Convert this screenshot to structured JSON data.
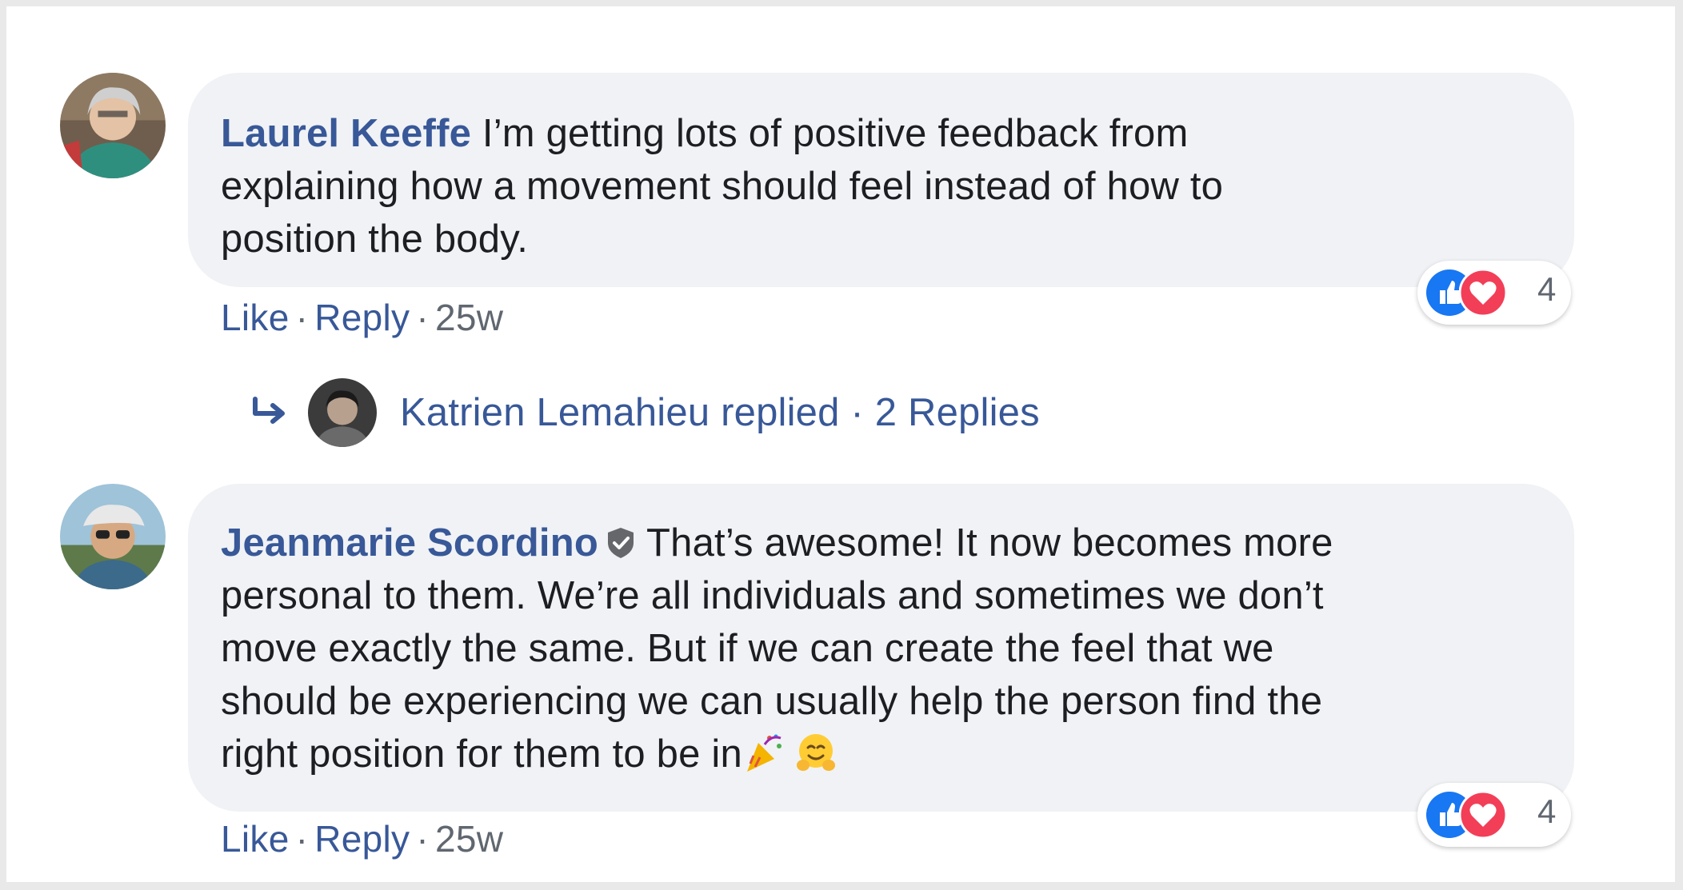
{
  "comments": [
    {
      "author": "Laurel Keeffe",
      "lines": [
        "I’m getting lots of positive feedback from",
        "explaining how a movement should feel instead of how to",
        "position the body."
      ],
      "actions": {
        "like": "Like",
        "reply": "Reply",
        "time": "25w",
        "dot": "·"
      },
      "reactions": {
        "icons": [
          "like-icon",
          "love-icon"
        ],
        "count": "4"
      }
    },
    {
      "author": "Jeanmarie Scordino",
      "verified_icon": "verified-badge-icon",
      "lines": [
        "That’s awesome! It now becomes more",
        "personal to them. We’re all individuals and sometimes we don’t",
        "move exactly the same. But if we can create the feel that we",
        "should be experiencing we can usually help the person find the",
        "right position for them to be in"
      ],
      "trailing_emojis": [
        "party-popper-icon",
        "hugging-face-icon"
      ],
      "actions": {
        "like": "Like",
        "reply": "Reply",
        "time": "25w",
        "dot": "·"
      },
      "reactions": {
        "icons": [
          "like-icon",
          "love-icon"
        ],
        "count": "4"
      }
    }
  ],
  "replies_row": {
    "icon": "reply-arrow-icon",
    "text": "Katrien Lemahieu replied · 2 Replies"
  },
  "colors": {
    "link_blue": "#385898",
    "bubble_bg": "#f0f2f5",
    "text": "#1c1e21",
    "meta_gray": "#606770",
    "like_blue": "#1877f2",
    "love_red": "#f33e58"
  }
}
